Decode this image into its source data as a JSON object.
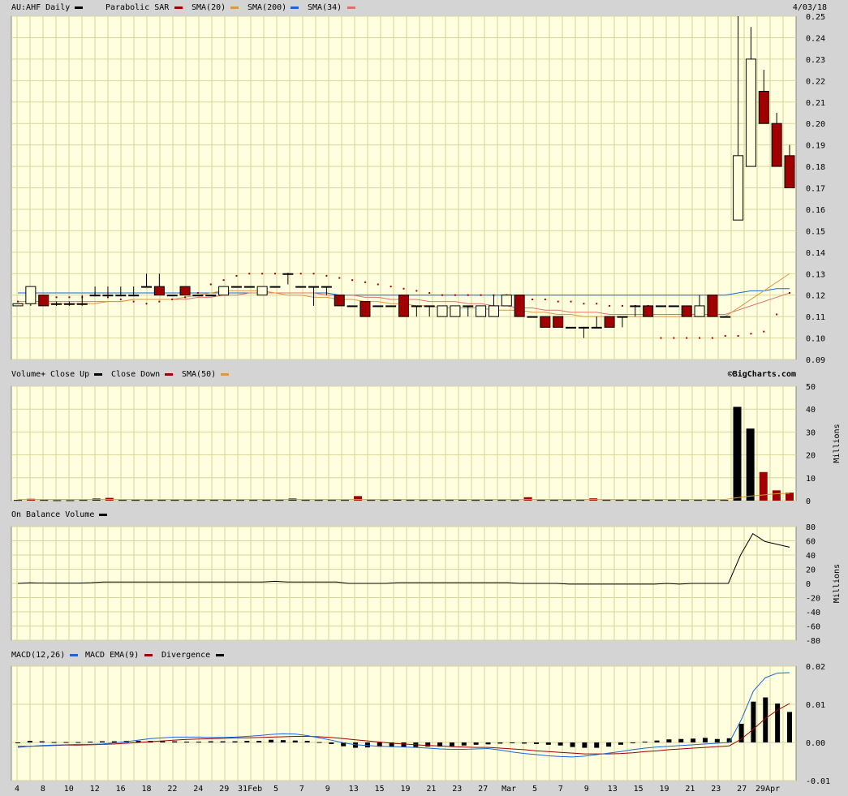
{
  "header": {
    "symbol": "AU:AHF Daily",
    "date": "4/03/18",
    "legend": [
      {
        "label": "Parabolic SAR",
        "color": "#a00000"
      },
      {
        "label": "SMA(20)",
        "color": "#d99a40"
      },
      {
        "label": "SMA(200)",
        "color": "#1a66d8"
      },
      {
        "label": "SMA(34)",
        "color": "#e07070"
      }
    ]
  },
  "volume_header": {
    "title": "Volume+",
    "legend": [
      {
        "label": "Close Up",
        "color": "#000000"
      },
      {
        "label": "Close Down",
        "color": "#a00000"
      },
      {
        "label": "SMA(50)",
        "color": "#d99a40"
      }
    ],
    "credit": "©BigCharts.com"
  },
  "obv_header": {
    "title": "On Balance Volume",
    "color": "#000000"
  },
  "macd_header": {
    "legend": [
      {
        "label": "MACD(12,26)",
        "color": "#1a66d8"
      },
      {
        "label": "MACD EMA(9)",
        "color": "#a00000"
      },
      {
        "label": "Divergence",
        "color": "#000000"
      }
    ]
  },
  "chart_data": [
    {
      "type": "candlestick",
      "ylim": [
        0.09,
        0.25
      ],
      "yticks": [
        "0.25",
        "0.24",
        "0.23",
        "0.22",
        "0.21",
        "0.20",
        "0.19",
        "0.18",
        "0.17",
        "0.16",
        "0.15",
        "0.14",
        "0.13",
        "0.12",
        "0.11",
        "0.10",
        "0.09"
      ],
      "grid": true,
      "candles": [
        {
          "o": 0.115,
          "h": 0.116,
          "l": 0.115,
          "c": 0.116
        },
        {
          "o": 0.116,
          "h": 0.124,
          "l": 0.115,
          "c": 0.124
        },
        {
          "o": 0.12,
          "h": 0.12,
          "l": 0.115,
          "c": 0.115
        },
        {
          "o": 0.116,
          "h": 0.117,
          "l": 0.115,
          "c": 0.116
        },
        {
          "o": 0.116,
          "h": 0.117,
          "l": 0.115,
          "c": 0.116
        },
        {
          "o": 0.116,
          "h": 0.12,
          "l": 0.115,
          "c": 0.116
        },
        {
          "o": 0.12,
          "h": 0.124,
          "l": 0.12,
          "c": 0.12
        },
        {
          "o": 0.12,
          "h": 0.124,
          "l": 0.12,
          "c": 0.12
        },
        {
          "o": 0.12,
          "h": 0.124,
          "l": 0.12,
          "c": 0.12
        },
        {
          "o": 0.12,
          "h": 0.124,
          "l": 0.12,
          "c": 0.12
        },
        {
          "o": 0.124,
          "h": 0.13,
          "l": 0.124,
          "c": 0.124
        },
        {
          "o": 0.124,
          "h": 0.13,
          "l": 0.12,
          "c": 0.12
        },
        {
          "o": 0.12,
          "h": 0.12,
          "l": 0.12,
          "c": 0.12
        },
        {
          "o": 0.124,
          "h": 0.124,
          "l": 0.12,
          "c": 0.12
        },
        {
          "o": 0.12,
          "h": 0.12,
          "l": 0.12,
          "c": 0.12
        },
        {
          "o": 0.12,
          "h": 0.12,
          "l": 0.12,
          "c": 0.12
        },
        {
          "o": 0.12,
          "h": 0.124,
          "l": 0.12,
          "c": 0.124
        },
        {
          "o": 0.124,
          "h": 0.124,
          "l": 0.124,
          "c": 0.124
        },
        {
          "o": 0.124,
          "h": 0.124,
          "l": 0.124,
          "c": 0.124
        },
        {
          "o": 0.12,
          "h": 0.124,
          "l": 0.12,
          "c": 0.124
        },
        {
          "o": 0.124,
          "h": 0.124,
          "l": 0.124,
          "c": 0.124
        },
        {
          "o": 0.13,
          "h": 0.13,
          "l": 0.125,
          "c": 0.13
        },
        {
          "o": 0.124,
          "h": 0.124,
          "l": 0.124,
          "c": 0.124
        },
        {
          "o": 0.124,
          "h": 0.124,
          "l": 0.115,
          "c": 0.124
        },
        {
          "o": 0.124,
          "h": 0.124,
          "l": 0.12,
          "c": 0.124
        },
        {
          "o": 0.12,
          "h": 0.12,
          "l": 0.115,
          "c": 0.115
        },
        {
          "o": 0.115,
          "h": 0.115,
          "l": 0.115,
          "c": 0.115
        },
        {
          "o": 0.117,
          "h": 0.117,
          "l": 0.11,
          "c": 0.11
        },
        {
          "o": 0.115,
          "h": 0.115,
          "l": 0.115,
          "c": 0.115
        },
        {
          "o": 0.115,
          "h": 0.115,
          "l": 0.115,
          "c": 0.115
        },
        {
          "o": 0.12,
          "h": 0.12,
          "l": 0.11,
          "c": 0.11
        },
        {
          "o": 0.115,
          "h": 0.115,
          "l": 0.11,
          "c": 0.115
        },
        {
          "o": 0.115,
          "h": 0.115,
          "l": 0.11,
          "c": 0.115
        },
        {
          "o": 0.11,
          "h": 0.115,
          "l": 0.11,
          "c": 0.115
        },
        {
          "o": 0.11,
          "h": 0.115,
          "l": 0.11,
          "c": 0.115
        },
        {
          "o": 0.115,
          "h": 0.115,
          "l": 0.11,
          "c": 0.115
        },
        {
          "o": 0.11,
          "h": 0.115,
          "l": 0.11,
          "c": 0.115
        },
        {
          "o": 0.11,
          "h": 0.12,
          "l": 0.11,
          "c": 0.115
        },
        {
          "o": 0.115,
          "h": 0.12,
          "l": 0.115,
          "c": 0.12
        },
        {
          "o": 0.12,
          "h": 0.12,
          "l": 0.11,
          "c": 0.11
        },
        {
          "o": 0.11,
          "h": 0.11,
          "l": 0.11,
          "c": 0.11
        },
        {
          "o": 0.11,
          "h": 0.11,
          "l": 0.105,
          "c": 0.105
        },
        {
          "o": 0.11,
          "h": 0.11,
          "l": 0.105,
          "c": 0.105
        },
        {
          "o": 0.105,
          "h": 0.105,
          "l": 0.105,
          "c": 0.105
        },
        {
          "o": 0.105,
          "h": 0.105,
          "l": 0.1,
          "c": 0.105
        },
        {
          "o": 0.105,
          "h": 0.11,
          "l": 0.105,
          "c": 0.105
        },
        {
          "o": 0.11,
          "h": 0.11,
          "l": 0.105,
          "c": 0.105
        },
        {
          "o": 0.11,
          "h": 0.11,
          "l": 0.105,
          "c": 0.11
        },
        {
          "o": 0.115,
          "h": 0.115,
          "l": 0.11,
          "c": 0.115
        },
        {
          "o": 0.115,
          "h": 0.115,
          "l": 0.11,
          "c": 0.11
        },
        {
          "o": 0.115,
          "h": 0.115,
          "l": 0.115,
          "c": 0.115
        },
        {
          "o": 0.115,
          "h": 0.115,
          "l": 0.115,
          "c": 0.115
        },
        {
          "o": 0.115,
          "h": 0.115,
          "l": 0.11,
          "c": 0.11
        },
        {
          "o": 0.11,
          "h": 0.12,
          "l": 0.11,
          "c": 0.115
        },
        {
          "o": 0.12,
          "h": 0.12,
          "l": 0.11,
          "c": 0.11
        },
        {
          "o": 0.11,
          "h": 0.11,
          "l": 0.11,
          "c": 0.11
        },
        {
          "o": 0.155,
          "h": 0.25,
          "l": 0.155,
          "c": 0.185
        },
        {
          "o": 0.18,
          "h": 0.245,
          "l": 0.18,
          "c": 0.23
        },
        {
          "o": 0.215,
          "h": 0.225,
          "l": 0.2,
          "c": 0.2
        },
        {
          "o": 0.2,
          "h": 0.205,
          "l": 0.18,
          "c": 0.18
        },
        {
          "o": 0.185,
          "h": 0.19,
          "l": 0.17,
          "c": 0.17
        }
      ],
      "sar": [
        0.117,
        0.117,
        0.118,
        0.119,
        0.119,
        0.119,
        0.12,
        0.119,
        0.118,
        0.117,
        0.116,
        0.117,
        0.118,
        0.119,
        0.121,
        0.125,
        0.127,
        0.129,
        0.13,
        0.13,
        0.13,
        0.13,
        0.13,
        0.13,
        0.129,
        0.128,
        0.127,
        0.126,
        0.125,
        0.124,
        0.123,
        0.122,
        0.121,
        0.12,
        0.12,
        0.12,
        0.12,
        0.12,
        0.12,
        0.119,
        0.118,
        0.118,
        0.117,
        0.117,
        0.116,
        0.116,
        0.115,
        0.115,
        0.115,
        0.115,
        0.1,
        0.1,
        0.1,
        0.1,
        0.1,
        0.101,
        0.101,
        0.102,
        0.103,
        0.111,
        0.121
      ],
      "sma20": [
        0.116,
        0.116,
        0.116,
        0.116,
        0.116,
        0.116,
        0.116,
        0.117,
        0.117,
        0.118,
        0.118,
        0.118,
        0.118,
        0.119,
        0.12,
        0.121,
        0.122,
        0.122,
        0.122,
        0.122,
        0.121,
        0.12,
        0.12,
        0.119,
        0.119,
        0.118,
        0.118,
        0.117,
        0.117,
        0.116,
        0.116,
        0.115,
        0.115,
        0.114,
        0.114,
        0.114,
        0.114,
        0.113,
        0.113,
        0.113,
        0.112,
        0.112,
        0.111,
        0.111,
        0.11,
        0.11,
        0.11,
        0.11,
        0.11,
        0.11,
        0.11,
        0.11,
        0.11,
        0.11,
        0.11,
        0.11,
        0.114,
        0.118,
        0.122,
        0.126,
        0.13
      ],
      "sma200": [
        0.121,
        0.121,
        0.121,
        0.121,
        0.121,
        0.121,
        0.121,
        0.121,
        0.121,
        0.121,
        0.121,
        0.121,
        0.121,
        0.121,
        0.121,
        0.121,
        0.121,
        0.121,
        0.121,
        0.121,
        0.121,
        0.121,
        0.121,
        0.121,
        0.121,
        0.12,
        0.12,
        0.12,
        0.12,
        0.12,
        0.12,
        0.12,
        0.12,
        0.12,
        0.12,
        0.12,
        0.12,
        0.12,
        0.12,
        0.12,
        0.12,
        0.12,
        0.12,
        0.12,
        0.12,
        0.12,
        0.12,
        0.12,
        0.12,
        0.12,
        0.12,
        0.12,
        0.12,
        0.12,
        0.12,
        0.12,
        0.121,
        0.122,
        0.122,
        0.123,
        0.123
      ],
      "sma34": [
        0.117,
        0.117,
        0.117,
        0.117,
        0.117,
        0.117,
        0.117,
        0.117,
        0.117,
        0.118,
        0.118,
        0.118,
        0.118,
        0.118,
        0.119,
        0.119,
        0.12,
        0.12,
        0.121,
        0.121,
        0.121,
        0.121,
        0.121,
        0.121,
        0.12,
        0.12,
        0.12,
        0.119,
        0.119,
        0.118,
        0.118,
        0.118,
        0.117,
        0.117,
        0.117,
        0.116,
        0.116,
        0.115,
        0.115,
        0.114,
        0.114,
        0.113,
        0.113,
        0.112,
        0.112,
        0.112,
        0.111,
        0.111,
        0.111,
        0.111,
        0.111,
        0.111,
        0.111,
        0.111,
        0.111,
        0.111,
        0.113,
        0.115,
        0.117,
        0.119,
        0.121
      ]
    },
    {
      "type": "bar",
      "title": "Volume+",
      "ylabel": "Millions",
      "ylim": [
        0,
        50
      ],
      "yticks": [
        "50",
        "40",
        "30",
        "20",
        "10",
        "0"
      ],
      "values": [
        0.3,
        0.8,
        0.3,
        0.2,
        0.2,
        0.3,
        0.9,
        1.2,
        0.3,
        0.3,
        0.3,
        0.3,
        0.3,
        0.3,
        0.3,
        0.3,
        0.3,
        0.3,
        0.3,
        0.3,
        0.3,
        0.9,
        0.3,
        0.3,
        0.3,
        0.3,
        2,
        0.3,
        0.3,
        0.6,
        0.3,
        0.3,
        0.3,
        0.3,
        0.5,
        0.3,
        0.5,
        0.3,
        0.3,
        1.5,
        0.3,
        0.3,
        0.3,
        0.3,
        1.0,
        0.3,
        0.3,
        0.3,
        0.3,
        0.3,
        0.3,
        0.3,
        0.3,
        0.3,
        0.3,
        41,
        31.5,
        12.5,
        4.5,
        3.5
      ],
      "up": [
        true,
        false,
        true,
        true,
        true,
        true,
        true,
        false,
        true,
        true,
        true,
        true,
        true,
        true,
        true,
        true,
        true,
        true,
        true,
        true,
        true,
        true,
        true,
        true,
        true,
        true,
        false,
        true,
        true,
        true,
        true,
        true,
        true,
        true,
        true,
        true,
        true,
        true,
        true,
        false,
        true,
        true,
        true,
        true,
        false,
        true,
        true,
        true,
        true,
        true,
        true,
        true,
        true,
        true,
        true,
        true,
        true,
        false,
        false,
        false
      ],
      "sma50": [
        0.5,
        0.5,
        0.5,
        0.5,
        0.5,
        0.5,
        0.5,
        0.5,
        0.5,
        0.5,
        0.5,
        0.5,
        0.5,
        0.5,
        0.5,
        0.5,
        0.5,
        0.5,
        0.5,
        0.5,
        0.5,
        0.5,
        0.5,
        0.5,
        0.5,
        0.5,
        0.5,
        0.5,
        0.5,
        0.5,
        0.5,
        0.5,
        0.5,
        0.5,
        0.5,
        0.5,
        0.5,
        0.5,
        0.5,
        0.5,
        0.5,
        0.5,
        0.5,
        0.5,
        0.5,
        0.5,
        0.5,
        0.5,
        0.5,
        0.5,
        0.5,
        0.5,
        0.5,
        0.5,
        0.5,
        1.3,
        2.0,
        2.5,
        3.0,
        3.2
      ]
    },
    {
      "type": "line",
      "title": "On Balance Volume",
      "ylabel": "Millions",
      "ylim": [
        -80,
        80
      ],
      "yticks": [
        "80",
        "60",
        "40",
        "20",
        "0",
        "-20",
        "-40",
        "-60",
        "-80"
      ],
      "values": [
        0,
        0.8,
        0.5,
        0.5,
        0.5,
        0.5,
        1,
        2,
        2,
        2,
        2,
        2,
        2,
        2,
        2,
        2,
        2,
        2,
        2,
        2,
        2,
        3,
        2,
        2,
        2,
        2,
        2,
        0,
        0,
        0,
        0,
        1,
        1,
        1,
        1,
        1,
        1,
        1,
        1,
        1,
        1,
        0,
        0,
        0,
        0,
        -1,
        -1,
        -1,
        -1,
        -1,
        -1,
        -1,
        -1,
        0,
        -1,
        0,
        0,
        0,
        0,
        40,
        70,
        59,
        55,
        51
      ]
    },
    {
      "type": "bar",
      "title": "MACD",
      "ylim": [
        -0.01,
        0.02
      ],
      "yticks": [
        "0.02",
        "0.01",
        "0.00",
        "-0.01"
      ],
      "divergence": [
        -0.0002,
        0.0004,
        0.0003,
        0.0001,
        0.0001,
        0.0001,
        0.0002,
        0.0003,
        0.0003,
        0.0004,
        0.0004,
        0.0004,
        0.0003,
        0.0003,
        0.0002,
        0.0002,
        0.0003,
        0.0003,
        0.0003,
        0.0004,
        0.0004,
        0.0007,
        0.0006,
        0.0005,
        0.0004,
        0.0001,
        -0.0004,
        -0.001,
        -0.0014,
        -0.0013,
        -0.0011,
        -0.0012,
        -0.0012,
        -0.0012,
        -0.0011,
        -0.0011,
        -0.001,
        -0.0008,
        -0.0006,
        -0.0005,
        -0.0003,
        -0.0002,
        -0.0003,
        -0.0004,
        -0.0006,
        -0.0008,
        -0.0012,
        -0.0014,
        -0.0014,
        -0.0011,
        -0.0006,
        -0.0002,
        0.0002,
        0.0005,
        0.0008,
        0.0009,
        0.001,
        0.0012,
        0.0009,
        0.0011,
        0.0049,
        0.0107,
        0.0118,
        0.0102,
        0.008
      ],
      "macd": [
        -0.0013,
        -0.001,
        -0.0008,
        -0.0007,
        -0.0006,
        -0.0005,
        -0.0005,
        -0.0004,
        -0.0001,
        0.0002,
        0.0006,
        0.001,
        0.0012,
        0.0014,
        0.0014,
        0.0014,
        0.0013,
        0.0013,
        0.0014,
        0.0016,
        0.0018,
        0.0021,
        0.0023,
        0.0022,
        0.0018,
        0.0012,
        0.0006,
        -0.0001,
        -0.0006,
        -0.0008,
        -0.001,
        -0.0011,
        -0.0012,
        -0.0013,
        -0.0015,
        -0.0017,
        -0.0018,
        -0.0018,
        -0.0017,
        -0.0016,
        -0.002,
        -0.0025,
        -0.0029,
        -0.0032,
        -0.0035,
        -0.0037,
        -0.0038,
        -0.0036,
        -0.0032,
        -0.0028,
        -0.0024,
        -0.0019,
        -0.0015,
        -0.0012,
        -0.001,
        -0.0008,
        -0.0006,
        -0.0004,
        -0.0002,
        0.0,
        0.006,
        0.0135,
        0.017,
        0.0182,
        0.0183
      ],
      "signal": [
        -0.001,
        -0.001,
        -0.0009,
        -0.0008,
        -0.0007,
        -0.0007,
        -0.0006,
        -0.0005,
        -0.0004,
        -0.0002,
        0.0,
        0.0002,
        0.0004,
        0.0006,
        0.0008,
        0.0009,
        0.001,
        0.0011,
        0.0012,
        0.0012,
        0.0013,
        0.0014,
        0.0015,
        0.0016,
        0.0016,
        0.0015,
        0.0013,
        0.001,
        0.0007,
        0.0004,
        0.0001,
        -0.0002,
        -0.0004,
        -0.0006,
        -0.0008,
        -0.0009,
        -0.0011,
        -0.0012,
        -0.0013,
        -0.0013,
        -0.0015,
        -0.0017,
        -0.0019,
        -0.0022,
        -0.0024,
        -0.0026,
        -0.0028,
        -0.003,
        -0.003,
        -0.003,
        -0.0029,
        -0.0027,
        -0.0024,
        -0.0022,
        -0.0019,
        -0.0017,
        -0.0015,
        -0.0013,
        -0.0011,
        -0.0009,
        0.0009,
        0.0035,
        0.0063,
        0.0085,
        0.0102
      ]
    }
  ],
  "x_axis": {
    "labels": [
      "4",
      "8",
      "10",
      "12",
      "16",
      "18",
      "22",
      "24",
      "29",
      "31Feb",
      "5",
      "7",
      "9",
      "13",
      "15",
      "19",
      "21",
      "23",
      "27",
      "Mar",
      "5",
      "7",
      "9",
      "13",
      "15",
      "19",
      "21",
      "23",
      "27",
      "29Apr"
    ]
  }
}
